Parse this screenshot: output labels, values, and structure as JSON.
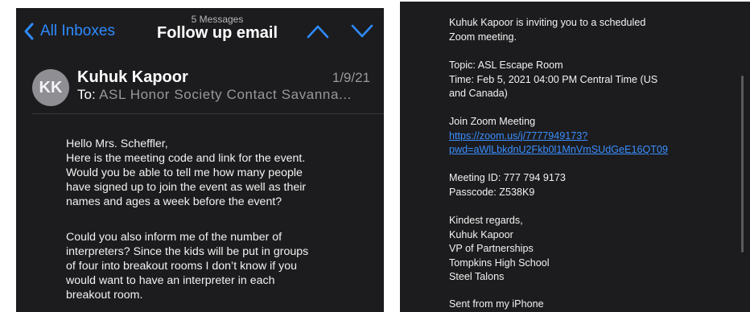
{
  "nav": {
    "back_label": "All Inboxes",
    "message_count": "5 Messages",
    "title": "Follow up email"
  },
  "email": {
    "avatar_initials": "KK",
    "sender": "Kuhuk Kapoor",
    "date": "1/9/21",
    "to_label": "To:",
    "to_value": "ASL Honor Society Contact Savanna..."
  },
  "body": {
    "para1": [
      "Hello Mrs. Scheffler,",
      "Here is the meeting code and link for the event.",
      "Would you be able to tell me how many people",
      "have signed up to join the event as well as their",
      "names and ages a week before the event?"
    ],
    "para2": [
      "Could you also inform me of the number of",
      "interpreters? Since the kids will be put in groups",
      "of four into breakout rooms I don’t know if you",
      "would want to have an interpreter in each",
      "breakout room."
    ]
  },
  "invite": {
    "intro": [
      "Kuhuk Kapoor is inviting you to a scheduled",
      "Zoom meeting."
    ],
    "topic": "Topic: ASL Escape Room",
    "time": [
      "Time: Feb 5, 2021 04:00 PM Central Time (US",
      "and Canada)"
    ],
    "join_label": "Join Zoom Meeting",
    "join_link": [
      "https://zoom.us/j/7777949173?",
      "pwd=aWlLbkdnU2Fkb0l1MnVmSUdGeE16QT09"
    ],
    "meeting_id": "Meeting ID: 777 794 9173",
    "passcode": "Passcode: Z538K9",
    "signature": [
      "Kindest regards,",
      "Kuhuk Kapoor",
      "VP of Partnerships",
      "Tompkins High School",
      "Steel Talons"
    ],
    "sent_from": "Sent from my iPhone"
  },
  "colors": {
    "background": "#1c1c1e",
    "accent_blue": "#2e8bff",
    "link_blue": "#3a8eff",
    "secondary_text": "#98989d"
  },
  "icons": [
    "chevron-left-icon",
    "chevron-up-icon",
    "chevron-down-icon"
  ]
}
